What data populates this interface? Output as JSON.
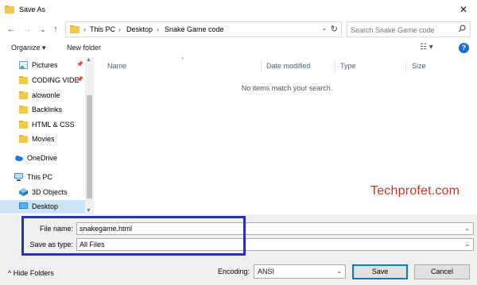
{
  "window": {
    "title": "Save As",
    "close_label": "✕"
  },
  "navigation": {
    "back": "←",
    "forward": "→",
    "dropdown": "⌄",
    "up": "↑",
    "breadcrumb": [
      "This PC",
      "Desktop",
      "Snake Game code"
    ],
    "separator": "›",
    "refresh": "↻"
  },
  "search": {
    "placeholder": "Search Snake Game code"
  },
  "toolbar": {
    "organize_label": "Organize ▾",
    "new_folder_label": "New folder",
    "view_icon": "☷ ▾",
    "help_label": "?"
  },
  "sidebar": {
    "items": [
      {
        "label": "Pictures",
        "icon": "pictures-icon",
        "pinned": true
      },
      {
        "label": "CODING VIDE",
        "icon": "folder-icon",
        "pinned": true
      },
      {
        "label": "alowonle",
        "icon": "folder-icon",
        "pinned": false
      },
      {
        "label": "Backlinks",
        "icon": "folder-icon",
        "pinned": false
      },
      {
        "label": "HTML & CSS",
        "icon": "folder-icon",
        "pinned": false
      },
      {
        "label": "Movies",
        "icon": "folder-icon",
        "pinned": false
      },
      {
        "label": "OneDrive",
        "icon": "cloud-icon",
        "pinned": false
      },
      {
        "label": "This PC",
        "icon": "computer-icon",
        "pinned": false
      },
      {
        "label": "3D Objects",
        "icon": "cube-icon",
        "pinned": false
      },
      {
        "label": "Desktop",
        "icon": "desktop-icon",
        "pinned": false,
        "selected": true
      }
    ]
  },
  "filelist": {
    "columns": [
      "Name",
      "Date modified",
      "Type",
      "Size"
    ],
    "empty_message": "No items match your search."
  },
  "watermark": "Techprofet.com",
  "save": {
    "file_name_label": "File name:",
    "file_name_value": "snakegame.html",
    "type_label": "Save as type:",
    "type_value": "All Files",
    "hide_folders_label": "Hide Folders",
    "encoding_label": "Encoding:",
    "encoding_value": "ANSI",
    "save_button": "Save",
    "cancel_button": "Cancel"
  },
  "colors": {
    "accent": "#0078d7",
    "highlight_border": "#2e2eb0",
    "watermark": "#c0392b",
    "folder": "#f2c94c"
  }
}
